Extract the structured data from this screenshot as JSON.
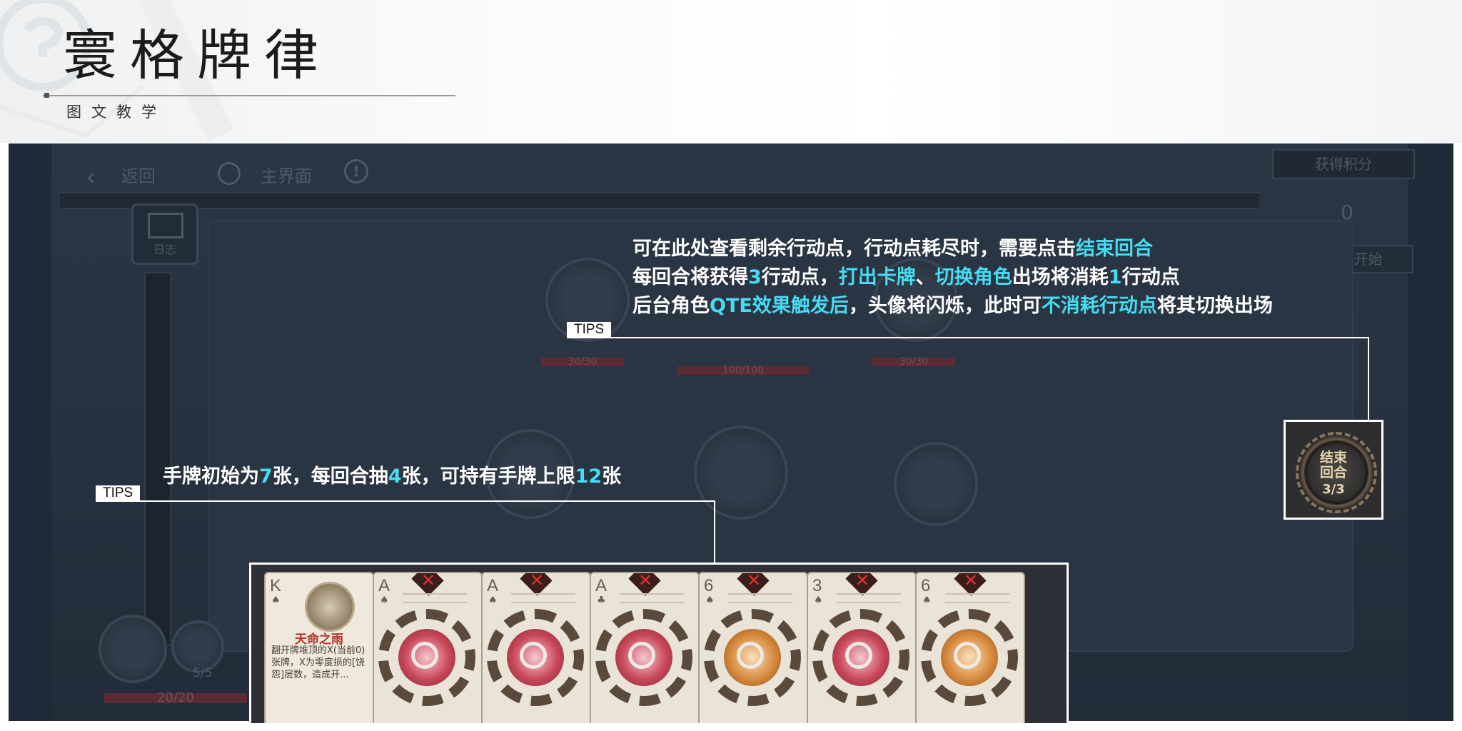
{
  "header": {
    "title": "寰格牌律",
    "subtitle": "图文教学"
  },
  "game": {
    "top_nav": {
      "back_label": "返回",
      "home_label": "主界面",
      "info_icon_glyph": "!"
    },
    "score_panel": {
      "header": "获得积分",
      "value": "0",
      "restart_label": "重新开始"
    },
    "log_button_label": "日志",
    "enemies": [
      {
        "hp": "30/30"
      },
      {
        "hp": "100/100"
      },
      {
        "hp": "30/30"
      }
    ],
    "player": {
      "hp": "20/20",
      "count": "5/5"
    },
    "end_turn": {
      "label_line1": "结束",
      "label_line2": "回合",
      "count": "3/3"
    },
    "hand": [
      {
        "rank": "K",
        "suit": "♠",
        "type": "character",
        "name": "天命之雨",
        "desc": "翻开牌堆顶的X(当前0)张牌，X为零度损的[饶怨]层数，造成开..."
      },
      {
        "rank": "A",
        "suit": "♠",
        "type": "red"
      },
      {
        "rank": "A",
        "suit": "♠",
        "type": "red"
      },
      {
        "rank": "A",
        "suit": "♣",
        "type": "red"
      },
      {
        "rank": "6",
        "suit": "♠",
        "type": "orange"
      },
      {
        "rank": "3",
        "suit": "♠",
        "type": "red"
      },
      {
        "rank": "6",
        "suit": "♠",
        "type": "orange"
      }
    ]
  },
  "tips": [
    {
      "tag": "TIPS",
      "lines": [
        [
          "可在此处查看剩余行动点，行动点耗尽时，需要点击",
          "结束回合",
          ""
        ],
        [
          "每回合将获得",
          "3",
          "行动点，",
          "打出卡牌",
          "、",
          "切换角色",
          "出场将消耗",
          "1",
          "行动点"
        ],
        [
          "后台角色",
          "QTE效果触发后",
          "，头像将闪烁，此时可",
          "不消耗行动点",
          "将其切换出场"
        ]
      ]
    },
    {
      "tag": "TIPS",
      "lines": [
        [
          "手牌初始为",
          "7",
          "张，每回合抽",
          "4",
          "张，可持有手牌上限",
          "12",
          "张"
        ]
      ]
    }
  ],
  "colors": {
    "highlight": "#47dcf2",
    "frame_bg": "#1e2a38",
    "tip_text": "#ffffff"
  }
}
